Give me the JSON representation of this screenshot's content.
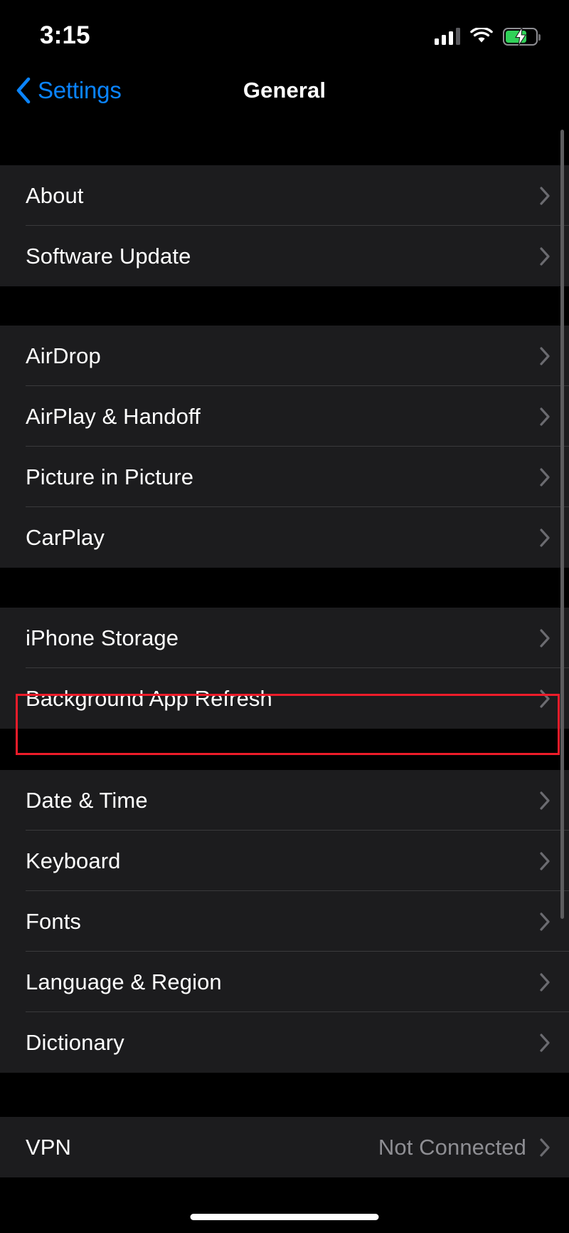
{
  "status_bar": {
    "time": "3:15",
    "cellular_icon": "cellular-bars-icon",
    "cellular_bars_active": 3,
    "cellular_bars_total": 4,
    "wifi_icon": "wifi-icon",
    "battery_icon": "battery-charging-icon",
    "battery_level_percent": 70,
    "battery_charging": true,
    "battery_color": "#30d158"
  },
  "nav": {
    "back_icon": "chevron-left-icon",
    "back_label": "Settings",
    "title": "General",
    "accent_color": "#0a84ff"
  },
  "highlight": {
    "target_row": "Background App Refresh",
    "color": "#ee1c2a"
  },
  "groups": [
    {
      "rows": [
        {
          "label": "About",
          "value": "",
          "accessory": "chevron-right-icon"
        },
        {
          "label": "Software Update",
          "value": "",
          "accessory": "chevron-right-icon"
        }
      ]
    },
    {
      "rows": [
        {
          "label": "AirDrop",
          "value": "",
          "accessory": "chevron-right-icon"
        },
        {
          "label": "AirPlay & Handoff",
          "value": "",
          "accessory": "chevron-right-icon"
        },
        {
          "label": "Picture in Picture",
          "value": "",
          "accessory": "chevron-right-icon"
        },
        {
          "label": "CarPlay",
          "value": "",
          "accessory": "chevron-right-icon"
        }
      ]
    },
    {
      "rows": [
        {
          "label": "iPhone Storage",
          "value": "",
          "accessory": "chevron-right-icon"
        },
        {
          "label": "Background App Refresh",
          "value": "",
          "accessory": "chevron-right-icon"
        }
      ]
    },
    {
      "rows": [
        {
          "label": "Date & Time",
          "value": "",
          "accessory": "chevron-right-icon"
        },
        {
          "label": "Keyboard",
          "value": "",
          "accessory": "chevron-right-icon"
        },
        {
          "label": "Fonts",
          "value": "",
          "accessory": "chevron-right-icon"
        },
        {
          "label": "Language & Region",
          "value": "",
          "accessory": "chevron-right-icon"
        },
        {
          "label": "Dictionary",
          "value": "",
          "accessory": "chevron-right-icon"
        }
      ]
    },
    {
      "rows": [
        {
          "label": "VPN",
          "value": "Not Connected",
          "accessory": "chevron-right-icon"
        }
      ]
    }
  ]
}
